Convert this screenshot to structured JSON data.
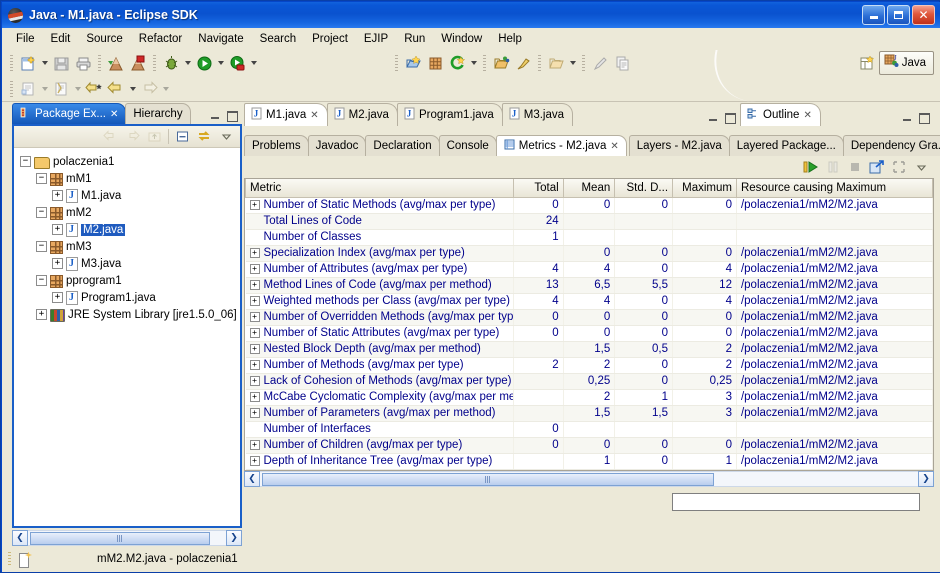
{
  "window": {
    "title": "Java - M1.java - Eclipse SDK",
    "logo_icon": "eclipse-logo",
    "minimize_label": "Minimize",
    "maximize_label": "Maximize",
    "close_label": "Close"
  },
  "menubar": {
    "items": [
      {
        "label": "File"
      },
      {
        "label": "Edit"
      },
      {
        "label": "Source"
      },
      {
        "label": "Refactor"
      },
      {
        "label": "Navigate"
      },
      {
        "label": "Search"
      },
      {
        "label": "Project"
      },
      {
        "label": "EJIP"
      },
      {
        "label": "Run"
      },
      {
        "label": "Window"
      },
      {
        "label": "Help"
      }
    ]
  },
  "toolbar": {
    "row1": [
      {
        "icon": "new-wizard-icon",
        "dropdown": true
      },
      {
        "icon": "save-icon",
        "dropdown": false
      },
      {
        "icon": "print-icon",
        "dropdown": false
      },
      {
        "icon": "build-all-icon",
        "dropdown": false
      },
      {
        "icon": "build-error-icon",
        "dropdown": false
      },
      {
        "icon": "debug-icon",
        "dropdown": true
      },
      {
        "icon": "run-icon",
        "dropdown": true
      },
      {
        "icon": "run-external-tools-icon",
        "dropdown": true
      }
    ],
    "row2": [
      {
        "icon": "new-java-class-icon",
        "dropdown": true
      },
      {
        "icon": "new-java-package-icon",
        "dropdown": true
      },
      {
        "icon": "next-annotation-icon",
        "dropdown": false
      },
      {
        "icon": "back-icon",
        "dropdown": true
      },
      {
        "icon": "forward-icon",
        "dropdown": true
      }
    ],
    "right1": [
      {
        "icon": "open-type-icon"
      },
      {
        "icon": "new-package-grid-icon"
      },
      {
        "icon": "search-icon",
        "dropdown": true
      },
      {
        "icon": "open-resource-icon"
      },
      {
        "icon": "pin-icon"
      },
      {
        "icon": "open-folder-icon",
        "dropdown": true
      },
      {
        "icon": "pencil-icon"
      },
      {
        "icon": "copy-icon"
      }
    ],
    "perspective": {
      "open_perspective_icon": "open-perspective-icon",
      "active_label": "Java",
      "active_icon": "java-perspective-icon"
    }
  },
  "package_explorer": {
    "tabs": [
      {
        "label": "Package Ex...",
        "icon": "package-explorer-icon",
        "active": true,
        "closable": true
      },
      {
        "label": "Hierarchy",
        "icon": "hierarchy-icon",
        "active": false,
        "closable": false
      }
    ],
    "toolbar_icons": [
      "back-icon",
      "forward-icon",
      "up-icon",
      "collapse-all-icon",
      "link-with-editor-icon",
      "view-menu-icon"
    ],
    "tree": [
      {
        "label": "polaczenia1",
        "icon": "project-icon",
        "depth": 0,
        "expander": "-",
        "selected": false
      },
      {
        "label": "mM1",
        "icon": "package-icon",
        "depth": 1,
        "expander": "-",
        "selected": false
      },
      {
        "label": "M1.java",
        "icon": "java-file-icon",
        "depth": 2,
        "expander": "+",
        "selected": false
      },
      {
        "label": "mM2",
        "icon": "package-icon",
        "depth": 1,
        "expander": "-",
        "selected": false
      },
      {
        "label": "M2.java",
        "icon": "java-file-icon",
        "depth": 2,
        "expander": "+",
        "selected": true
      },
      {
        "label": "mM3",
        "icon": "package-icon",
        "depth": 1,
        "expander": "-",
        "selected": false
      },
      {
        "label": "M3.java",
        "icon": "java-file-icon",
        "depth": 2,
        "expander": "+",
        "selected": false
      },
      {
        "label": "pprogram1",
        "icon": "package-icon",
        "depth": 1,
        "expander": "-",
        "selected": false
      },
      {
        "label": "Program1.java",
        "icon": "java-file-icon",
        "depth": 2,
        "expander": "+",
        "selected": false
      },
      {
        "label": "JRE System Library [jre1.5.0_06]",
        "icon": "jre-library-icon",
        "depth": 1,
        "expander": "+",
        "selected": false
      }
    ],
    "scroll_left_label": "❮",
    "scroll_right_label": "❯"
  },
  "editor": {
    "tabs": [
      {
        "label": "M1.java",
        "icon": "java-file-icon",
        "active": true,
        "closable": true
      },
      {
        "label": "M2.java",
        "icon": "java-file-icon",
        "active": false,
        "closable": false
      },
      {
        "label": "Program1.java",
        "icon": "java-file-icon",
        "active": false,
        "closable": false
      },
      {
        "label": "M3.java",
        "icon": "java-file-icon",
        "active": false,
        "closable": false
      }
    ]
  },
  "outline": {
    "tabs": [
      {
        "label": "Outline",
        "icon": "outline-icon",
        "active": true,
        "closable": true
      }
    ]
  },
  "bottom_view": {
    "tabs": [
      {
        "label": "Problems",
        "icon": "",
        "active": false,
        "closable": false
      },
      {
        "label": "Javadoc",
        "icon": "",
        "active": false,
        "closable": false
      },
      {
        "label": "Declaration",
        "icon": "",
        "active": false,
        "closable": false
      },
      {
        "label": "Console",
        "icon": "",
        "active": false,
        "closable": false
      },
      {
        "label": "Metrics - M2.java",
        "icon": "metrics-icon",
        "active": true,
        "closable": true
      },
      {
        "label": "Layers - M2.java",
        "icon": "",
        "active": false,
        "closable": false
      },
      {
        "label": "Layered Package...",
        "icon": "",
        "active": false,
        "closable": false
      },
      {
        "label": "Dependency Gra...",
        "icon": "",
        "active": false,
        "closable": false
      }
    ],
    "toolbar_icons": [
      "run-metrics-icon",
      "pause-icon",
      "stop-icon",
      "export-icon",
      "select-all-icon",
      "view-menu-icon"
    ],
    "filter_placeholder": "",
    "filter_value": ""
  },
  "metrics_table": {
    "columns": [
      "Metric",
      "Total",
      "Mean",
      "Std. D...",
      "Maximum",
      "Resource causing Maximum"
    ],
    "rows": [
      {
        "expandable": true,
        "metric": "Number of Static Methods (avg/max per type)",
        "total": "0",
        "mean": "0",
        "std": "0",
        "max": "0",
        "resource": "/polaczenia1/mM2/M2.java"
      },
      {
        "expandable": false,
        "metric": "Total Lines of Code",
        "total": "24",
        "mean": "",
        "std": "",
        "max": "",
        "resource": ""
      },
      {
        "expandable": false,
        "metric": "Number of Classes",
        "total": "1",
        "mean": "",
        "std": "",
        "max": "",
        "resource": ""
      },
      {
        "expandable": true,
        "metric": "Specialization Index (avg/max per type)",
        "total": "",
        "mean": "0",
        "std": "0",
        "max": "0",
        "resource": "/polaczenia1/mM2/M2.java"
      },
      {
        "expandable": true,
        "metric": "Number of Attributes (avg/max per type)",
        "total": "4",
        "mean": "4",
        "std": "0",
        "max": "4",
        "resource": "/polaczenia1/mM2/M2.java"
      },
      {
        "expandable": true,
        "metric": "Method Lines of Code (avg/max per method)",
        "total": "13",
        "mean": "6,5",
        "std": "5,5",
        "max": "12",
        "resource": "/polaczenia1/mM2/M2.java"
      },
      {
        "expandable": true,
        "metric": "Weighted methods per Class (avg/max per type)",
        "total": "4",
        "mean": "4",
        "std": "0",
        "max": "4",
        "resource": "/polaczenia1/mM2/M2.java"
      },
      {
        "expandable": true,
        "metric": "Number of Overridden Methods (avg/max per type)",
        "total": "0",
        "mean": "0",
        "std": "0",
        "max": "0",
        "resource": "/polaczenia1/mM2/M2.java"
      },
      {
        "expandable": true,
        "metric": "Number of Static Attributes (avg/max per type)",
        "total": "0",
        "mean": "0",
        "std": "0",
        "max": "0",
        "resource": "/polaczenia1/mM2/M2.java"
      },
      {
        "expandable": true,
        "metric": "Nested Block Depth (avg/max per method)",
        "total": "",
        "mean": "1,5",
        "std": "0,5",
        "max": "2",
        "resource": "/polaczenia1/mM2/M2.java"
      },
      {
        "expandable": true,
        "metric": "Number of Methods (avg/max per type)",
        "total": "2",
        "mean": "2",
        "std": "0",
        "max": "2",
        "resource": "/polaczenia1/mM2/M2.java"
      },
      {
        "expandable": true,
        "metric": "Lack of Cohesion of Methods (avg/max per type)",
        "total": "",
        "mean": "0,25",
        "std": "0",
        "max": "0,25",
        "resource": "/polaczenia1/mM2/M2.java"
      },
      {
        "expandable": true,
        "metric": "McCabe Cyclomatic Complexity (avg/max per metho",
        "total": "",
        "mean": "2",
        "std": "1",
        "max": "3",
        "resource": "/polaczenia1/mM2/M2.java"
      },
      {
        "expandable": true,
        "metric": "Number of Parameters (avg/max per method)",
        "total": "",
        "mean": "1,5",
        "std": "1,5",
        "max": "3",
        "resource": "/polaczenia1/mM2/M2.java"
      },
      {
        "expandable": false,
        "metric": "Number of Interfaces",
        "total": "0",
        "mean": "",
        "std": "",
        "max": "",
        "resource": ""
      },
      {
        "expandable": true,
        "metric": "Number of Children (avg/max per type)",
        "total": "0",
        "mean": "0",
        "std": "0",
        "max": "0",
        "resource": "/polaczenia1/mM2/M2.java"
      },
      {
        "expandable": true,
        "metric": "Depth of Inheritance Tree (avg/max per type)",
        "total": "",
        "mean": "1",
        "std": "0",
        "max": "1",
        "resource": "/polaczenia1/mM2/M2.java"
      }
    ]
  },
  "statusbar": {
    "icon": "editor-marker-icon",
    "text": "mM2.M2.java - polaczenia1"
  },
  "colors": {
    "title_blue": "#0a52cf",
    "chrome": "#ece9d8",
    "selection_blue": "#1f5bbf",
    "table_text": "#00008b",
    "view_border": "#1a5fc8"
  }
}
